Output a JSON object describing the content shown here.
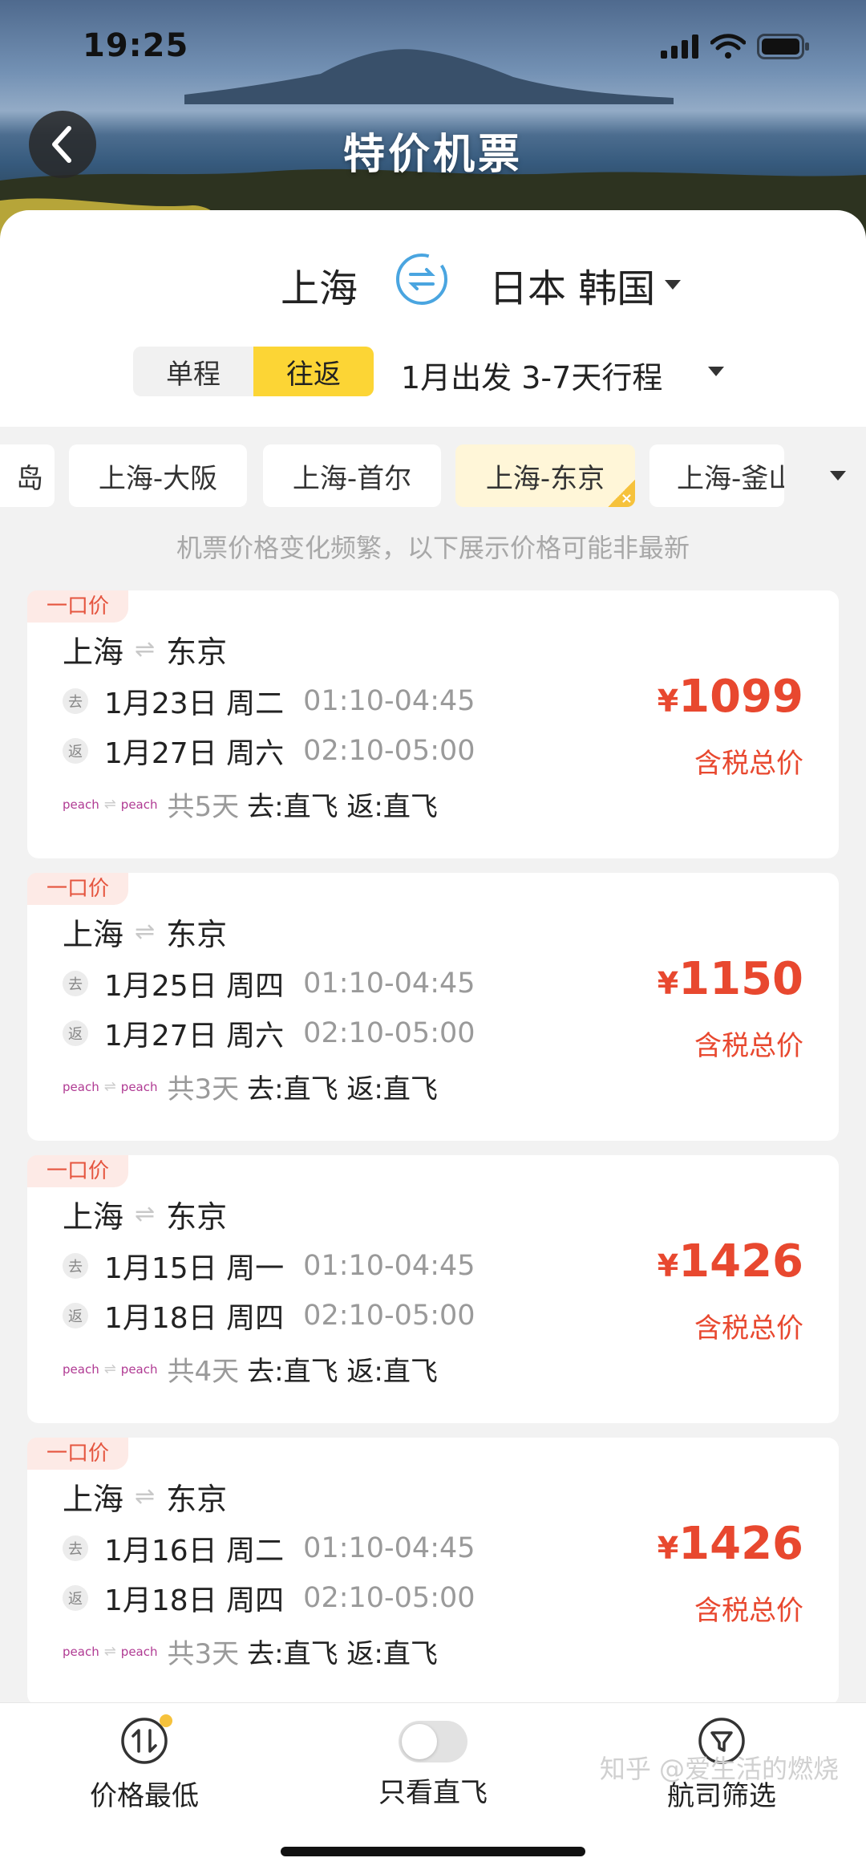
{
  "status_bar": {
    "time": "19:25"
  },
  "header": {
    "title": "特价机票"
  },
  "route": {
    "from": "上海",
    "to": "日本 韩国"
  },
  "trip": {
    "options": [
      "单程",
      "往返"
    ],
    "selected": "往返",
    "description": "1月出发 3-7天行程"
  },
  "route_chips": [
    {
      "label": "岛",
      "selected": false
    },
    {
      "label": "上海-大阪",
      "selected": false
    },
    {
      "label": "上海-首尔",
      "selected": false
    },
    {
      "label": "上海-东京",
      "selected": true
    },
    {
      "label": "上海-釜山",
      "selected": false
    }
  ],
  "notice": "机票价格变化频繁，以下展示价格可能非最新",
  "flights": [
    {
      "badge": "一口价",
      "from": "上海",
      "to": "东京",
      "outbound": {
        "tag": "去",
        "date": "1月23日 周二",
        "time": "01:10-04:45"
      },
      "inbound": {
        "tag": "返",
        "date": "1月27日 周六",
        "time": "02:10-05:00"
      },
      "airline": "peach",
      "duration": "共5天",
      "directs": "去:直飞 返:直飞",
      "currency": "¥",
      "price": "1099",
      "price_note": "含税总价"
    },
    {
      "badge": "一口价",
      "from": "上海",
      "to": "东京",
      "outbound": {
        "tag": "去",
        "date": "1月25日 周四",
        "time": "01:10-04:45"
      },
      "inbound": {
        "tag": "返",
        "date": "1月27日 周六",
        "time": "02:10-05:00"
      },
      "airline": "peach",
      "duration": "共3天",
      "directs": "去:直飞 返:直飞",
      "currency": "¥",
      "price": "1150",
      "price_note": "含税总价"
    },
    {
      "badge": "一口价",
      "from": "上海",
      "to": "东京",
      "outbound": {
        "tag": "去",
        "date": "1月15日 周一",
        "time": "01:10-04:45"
      },
      "inbound": {
        "tag": "返",
        "date": "1月18日 周四",
        "time": "02:10-05:00"
      },
      "airline": "peach",
      "duration": "共4天",
      "directs": "去:直飞 返:直飞",
      "currency": "¥",
      "price": "1426",
      "price_note": "含税总价"
    },
    {
      "badge": "一口价",
      "from": "上海",
      "to": "东京",
      "outbound": {
        "tag": "去",
        "date": "1月16日 周二",
        "time": "01:10-04:45"
      },
      "inbound": {
        "tag": "返",
        "date": "1月18日 周四",
        "time": "02:10-05:00"
      },
      "airline": "peach",
      "duration": "共3天",
      "directs": "去:直飞 返:直飞",
      "currency": "¥",
      "price": "1426",
      "price_note": "含税总价"
    }
  ],
  "bottom_bar": {
    "sort_label": "价格最低",
    "direct_label": "只看直飞",
    "direct_only": false,
    "filter_label": "航司筛选"
  },
  "watermark": "知乎 @爱生活的燃烧",
  "colors": {
    "accent": "#fcd535",
    "price": "#e8482f",
    "badge_bg": "#fdeae6"
  },
  "icons": [
    "back-arrow-icon",
    "swap-icon",
    "caret-down-icon",
    "sort-icon",
    "filter-icon",
    "signal-icon",
    "wifi-icon",
    "battery-icon"
  ]
}
